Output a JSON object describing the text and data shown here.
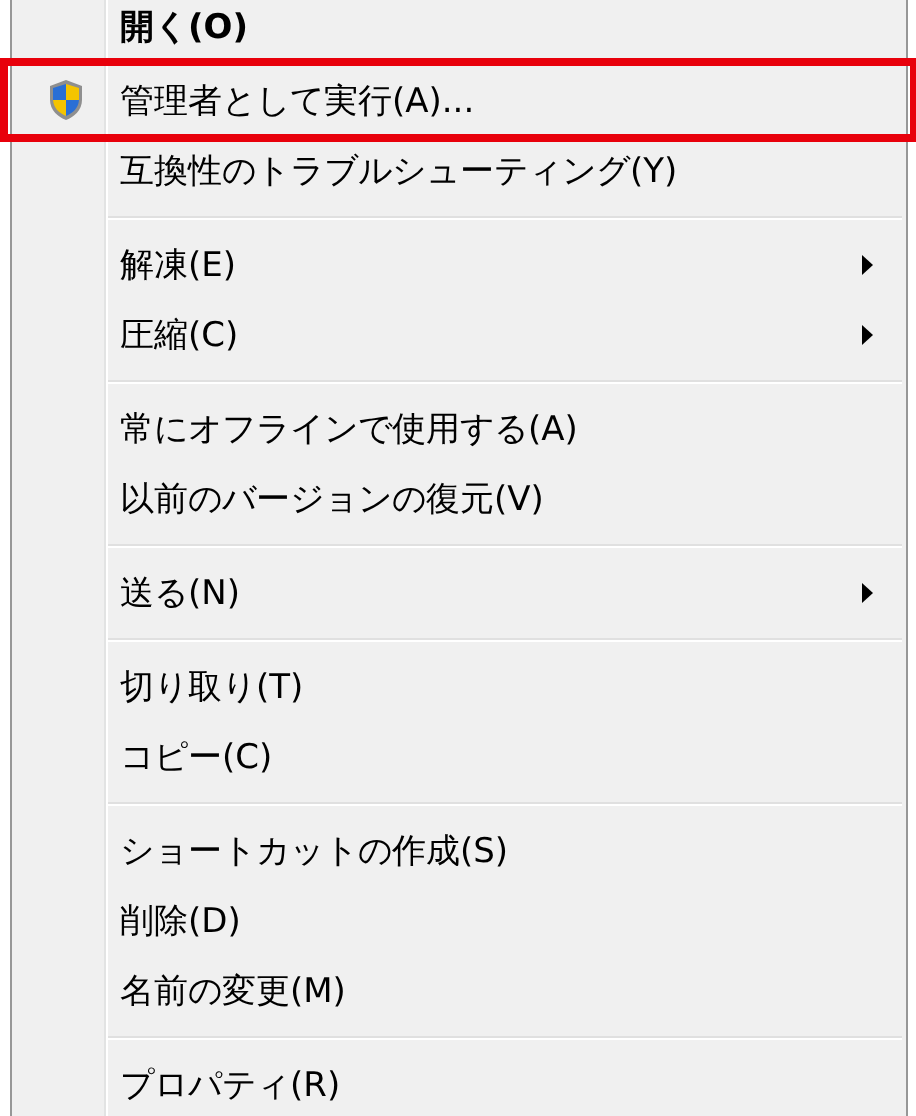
{
  "context_menu": {
    "groups": [
      {
        "items": [
          {
            "label": "開く(O)",
            "default": true,
            "highlighted": false,
            "submenu": false
          },
          {
            "label": "管理者として実行(A)...",
            "default": false,
            "highlighted": true,
            "submenu": false,
            "kind": "elevated"
          },
          {
            "label": "互換性のトラブルシューティング(Y)",
            "default": false,
            "highlighted": false,
            "submenu": false
          }
        ]
      },
      {
        "items": [
          {
            "label": "解凍(E)",
            "default": false,
            "highlighted": false,
            "submenu": true
          },
          {
            "label": "圧縮(C)",
            "default": false,
            "highlighted": false,
            "submenu": true
          }
        ]
      },
      {
        "items": [
          {
            "label": "常にオフラインで使用する(A)",
            "default": false,
            "highlighted": false,
            "submenu": false
          },
          {
            "label": "以前のバージョンの復元(V)",
            "default": false,
            "highlighted": false,
            "submenu": false
          }
        ]
      },
      {
        "items": [
          {
            "label": "送る(N)",
            "default": false,
            "highlighted": false,
            "submenu": true
          }
        ]
      },
      {
        "items": [
          {
            "label": "切り取り(T)",
            "default": false,
            "highlighted": false,
            "submenu": false
          },
          {
            "label": "コピー(C)",
            "default": false,
            "highlighted": false,
            "submenu": false
          }
        ]
      },
      {
        "items": [
          {
            "label": "ショートカットの作成(S)",
            "default": false,
            "highlighted": false,
            "submenu": false
          },
          {
            "label": "削除(D)",
            "default": false,
            "highlighted": false,
            "submenu": false
          },
          {
            "label": "名前の変更(M)",
            "default": false,
            "highlighted": false,
            "submenu": false
          }
        ]
      },
      {
        "items": [
          {
            "label": "プロパティ(R)",
            "default": false,
            "highlighted": false,
            "submenu": false
          }
        ]
      }
    ]
  }
}
